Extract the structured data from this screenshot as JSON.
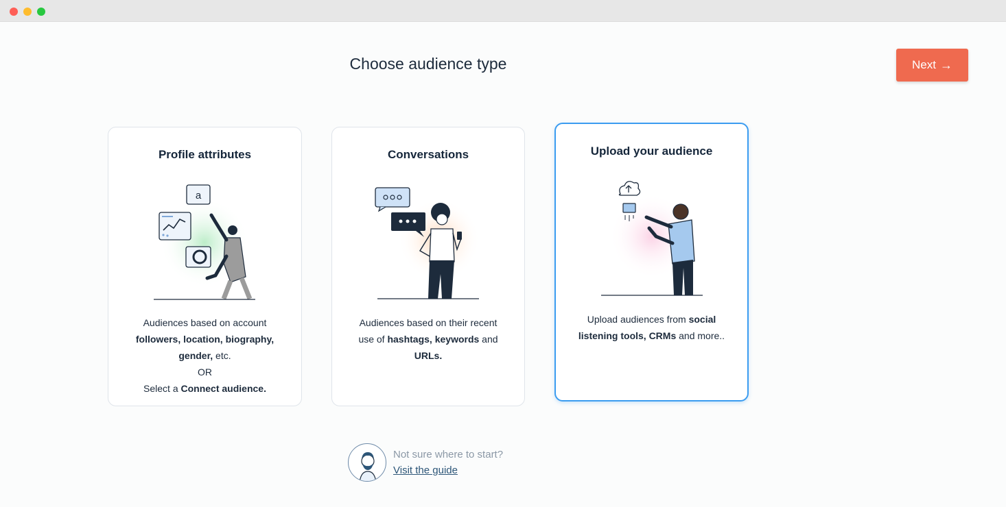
{
  "header": {
    "title": "Choose audience type",
    "next_label": "Next"
  },
  "cards": [
    {
      "title": "Profile attributes",
      "desc": [
        [
          "Audiences based on account",
          ""
        ],
        [
          "",
          "followers, location, biography,"
        ],
        [
          "",
          "gender,",
          " etc."
        ],
        [
          "OR",
          ""
        ],
        [
          "Select a ",
          "Connect audience."
        ]
      ]
    },
    {
      "title": "Conversations",
      "desc": [
        [
          "Audiences based on their recent",
          ""
        ],
        [
          "use of ",
          "hashtags, keywords",
          " and"
        ],
        [
          "",
          "URLs."
        ]
      ]
    },
    {
      "title": "Upload your audience",
      "desc": [
        [
          "Upload audiences from ",
          "social"
        ],
        [
          "",
          "listening tools, CRMs",
          " and more.."
        ]
      ]
    }
  ],
  "help": {
    "question": "Not sure where to start?",
    "link_label": "Visit the guide"
  },
  "colors": {
    "accent": "#ef6a4f",
    "selected_border": "#3b9cf0",
    "text": "#15263a"
  },
  "icons": [
    "analytics-figure-illustration",
    "chat-bubbles-illustration",
    "cloud-upload-illustration",
    "guide-avatar-icon"
  ]
}
